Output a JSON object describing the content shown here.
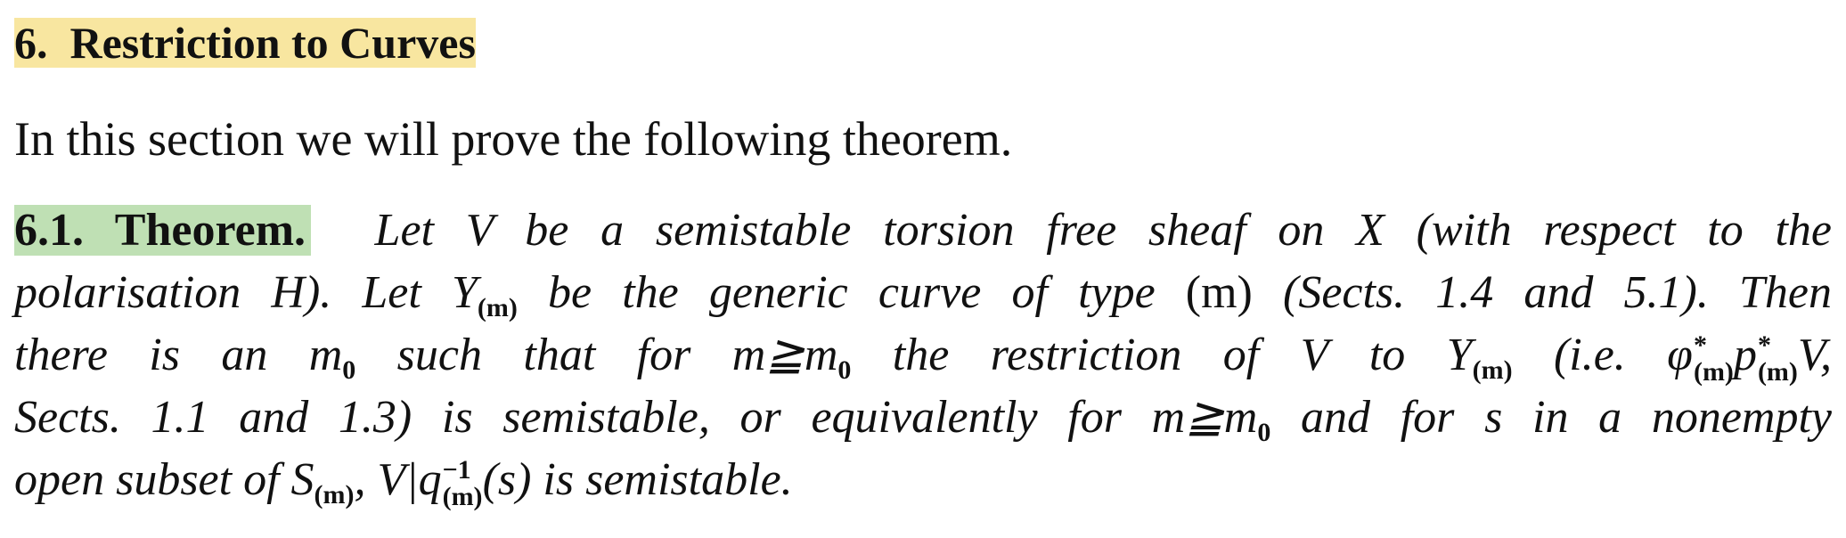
{
  "section": {
    "number": "6.",
    "title": "Restriction to Curves"
  },
  "intro": "In this section we will prove the following theorem.",
  "theorem": {
    "label": "6.1. Theorem.",
    "line1_a": "Let V be a semistable torsion free sheaf on X (with respect to the",
    "line2_a": "polarisation H). Let Y",
    "line2_sub1": "(m)",
    "line2_b": " be the generic curve of type ",
    "line2_m": "(m)",
    "line2_c": " (Sects. 1.4 and 5.1). Then",
    "line3_a": "there is an m",
    "line3_sub0": "0",
    "line3_b": " such that for m≧m",
    "line3_sub0b": "0",
    "line3_c": " the restriction of V to Y",
    "line3_sub1": "(m)",
    "line3_d": " (i.e. φ",
    "line3_star1": "*",
    "line3_sub2": "(m)",
    "line3_e": "p",
    "line3_star2": "*",
    "line3_sub3": "(m)",
    "line3_f": "V,",
    "line4_a": "Sects. 1.1 and 1.3) is semistable, or equivalently for m≧m",
    "line4_sub0": "0",
    "line4_b": " and for s in a nonempty",
    "line5_a": "open subset of S",
    "line5_sub1": "(m)",
    "line5_b": ", V|q",
    "line5_sup": "−1",
    "line5_sub2": "(m)",
    "line5_c": "(s) is semistable."
  }
}
